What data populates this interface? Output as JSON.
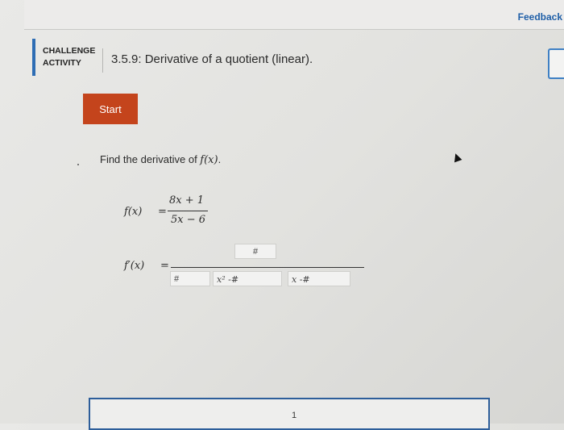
{
  "top": {
    "feedback_label": "Feedback"
  },
  "header": {
    "challenge_label": "CHALLENGE\nACTIVITY",
    "activity_title": "3.5.9: Derivative of a quotient (linear)."
  },
  "start_button": {
    "label": "Start"
  },
  "problem": {
    "prompt_prefix": "Find the derivative of ",
    "prompt_fx": "f(x)",
    "prompt_suffix": ".",
    "fx_label": "f(x)",
    "equals": "=",
    "numerator": "8x + 1",
    "denominator": "5x − 6",
    "fprime_label": "f′(x)",
    "fprime_equals": "="
  },
  "answer_boxes": {
    "numerator": "#",
    "coef": "#",
    "x2_term": "x² -#",
    "x_term": "x -#"
  },
  "footer": {
    "page_number": "1"
  },
  "colors": {
    "accent": "#2e6db4",
    "start_button": "#c4441c",
    "panel_border": "#2d5e9a"
  },
  "icons": {
    "cursor": "mouse-cursor-icon"
  }
}
